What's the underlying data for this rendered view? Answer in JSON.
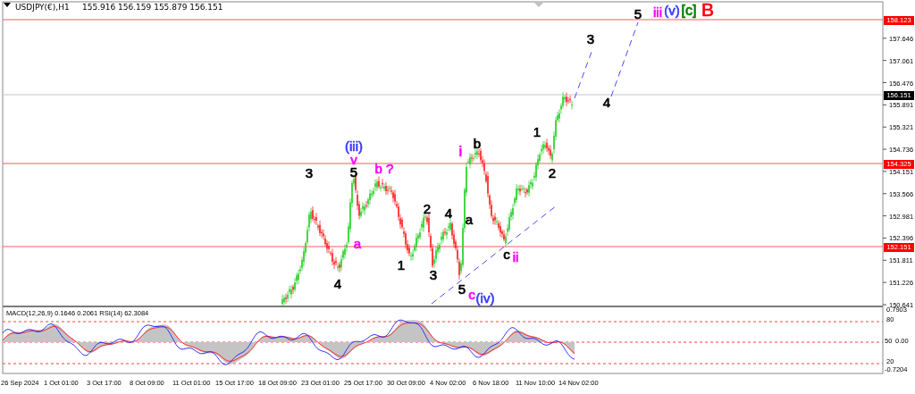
{
  "chart_header": {
    "symbol": "USDJPY(€),H1",
    "quotes": "155.916 156.159 155.879 156.151"
  },
  "price_axis": {
    "ticks": [
      "157.646",
      "157.061",
      "156.476",
      "155.891",
      "155.321",
      "154.736",
      "154.151",
      "153.566",
      "152.981",
      "152.396",
      "151.811",
      "151.226",
      "150.641"
    ],
    "levels": [
      {
        "label": "158.123",
        "kind": "level"
      },
      {
        "label": "156.151",
        "kind": "current"
      },
      {
        "label": "154.325",
        "kind": "level"
      },
      {
        "label": "152.151",
        "kind": "level"
      }
    ]
  },
  "wave_labels": [
    {
      "text": "3",
      "color": "#000000"
    },
    {
      "text": "4",
      "color": "#000000"
    },
    {
      "text": "(iii)",
      "color": "#3b3bff"
    },
    {
      "text": "v",
      "color": "#ff00ff"
    },
    {
      "text": "5",
      "color": "#000000"
    },
    {
      "text": "a",
      "color": "#ff00ff"
    },
    {
      "text": "b ?",
      "color": "#ff00ff"
    },
    {
      "text": "1",
      "color": "#000000"
    },
    {
      "text": "2",
      "color": "#000000"
    },
    {
      "text": "3",
      "color": "#000000"
    },
    {
      "text": "4",
      "color": "#000000"
    },
    {
      "text": "i",
      "color": "#ff00ff"
    },
    {
      "text": "5",
      "color": "#000000"
    },
    {
      "text": "a",
      "color": "#000000"
    },
    {
      "text": "c",
      "color": "#ff00ff"
    },
    {
      "text": "b",
      "color": "#000000"
    },
    {
      "text": "(iv)",
      "color": "#3b3bff"
    },
    {
      "text": "c",
      "color": "#000000"
    },
    {
      "text": "ii",
      "color": "#ff00ff"
    },
    {
      "text": "1",
      "color": "#000000"
    },
    {
      "text": "2",
      "color": "#000000"
    },
    {
      "text": "3",
      "color": "#000000"
    },
    {
      "text": "4",
      "color": "#000000"
    },
    {
      "text": "5",
      "color": "#000000"
    },
    {
      "text": "iii",
      "color": "#ff00ff"
    },
    {
      "text": "(v)",
      "color": "#3b3bff"
    },
    {
      "text": "[c]",
      "color": "#008000"
    },
    {
      "text": "B",
      "color": "#ff0000"
    }
  ],
  "indicator": {
    "title": "MACD(12,26,9) 0.1646 0.2061  RSI(14) 62.3084",
    "scale": [
      "0.7903",
      "80",
      "50",
      "0.00",
      "20",
      "-0.7204"
    ]
  },
  "time_axis": [
    "26 Sep 2024",
    "1 Oct 01:00",
    "3 Oct 17:00",
    "8 Oct 09:00",
    "11 Oct 01:00",
    "15 Oct 17:00",
    "18 Oct 09:00",
    "23 Oct 01:00",
    "25 Oct 17:00",
    "30 Oct 09:00",
    "4 Nov 02:00",
    "6 Nov 18:00",
    "11 Nov 10:00",
    "14 Nov 02:00"
  ]
}
